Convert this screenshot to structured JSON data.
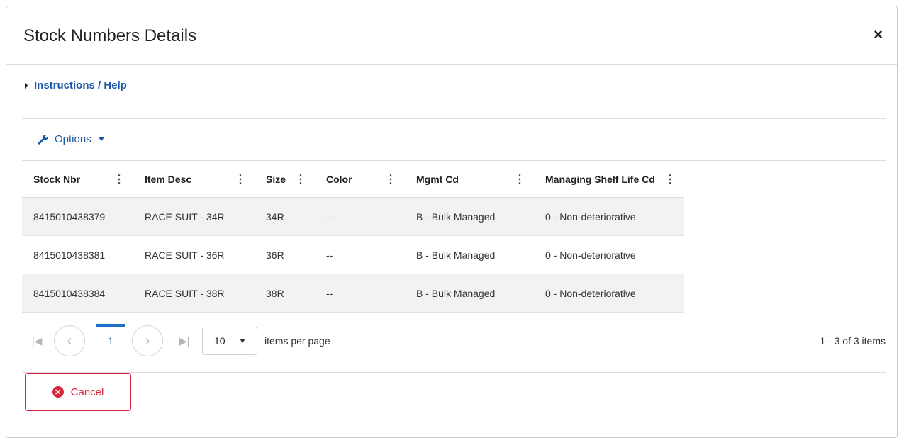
{
  "modal": {
    "title": "Stock Numbers Details",
    "close_glyph": "×"
  },
  "help": {
    "label": "Instructions / Help"
  },
  "toolbar": {
    "options_label": "Options"
  },
  "table": {
    "columns": [
      "Stock Nbr",
      "Item Desc",
      "Size",
      "Color",
      "Mgmt Cd",
      "Managing Shelf Life Cd"
    ],
    "rows": [
      [
        "8415010438379",
        "RACE SUIT - 34R",
        "34R",
        "--",
        "B - Bulk Managed",
        "0 - Non-deteriorative"
      ],
      [
        "8415010438381",
        "RACE SUIT - 36R",
        "36R",
        "--",
        "B - Bulk Managed",
        "0 - Non-deteriorative"
      ],
      [
        "8415010438384",
        "RACE SUIT - 38R",
        "38R",
        "--",
        "B - Bulk Managed",
        "0 - Non-deteriorative"
      ]
    ]
  },
  "pager": {
    "current_page": "1",
    "page_size": "10",
    "page_size_label": "items per page",
    "count_text": "1 - 3 of 3 items"
  },
  "footer": {
    "cancel_label": "Cancel"
  },
  "colors": {
    "link": "#1a56a8",
    "danger": "#d9253d",
    "row_alt": "#f2f2f2"
  }
}
